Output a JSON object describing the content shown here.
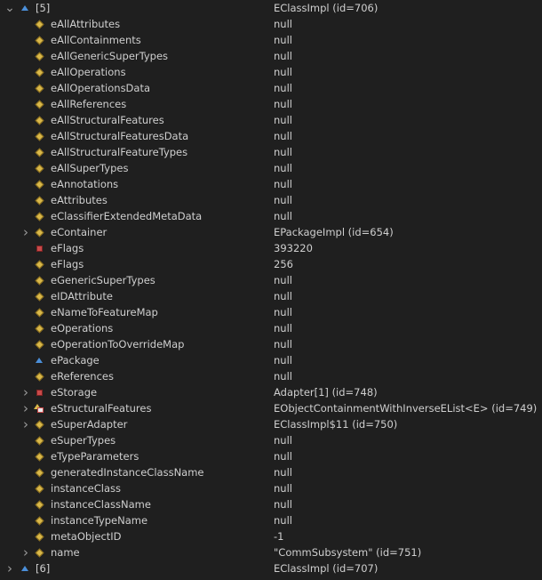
{
  "colors": {
    "background": "#1f1f1f",
    "text": "#cfcfcf",
    "diamond": "#d9b84a",
    "square": "#c94a4a",
    "triangle": "#4b8fd9"
  },
  "rows": [
    {
      "twisty": "chevron-down-icon",
      "icon": "triangle-blue-icon",
      "name": "[5]",
      "value": "EClassImpl  (id=706)",
      "level": 0
    },
    {
      "twisty": "",
      "icon": "diamond-yellow-icon",
      "name": "eAllAttributes",
      "value": "null",
      "level": 1
    },
    {
      "twisty": "",
      "icon": "diamond-yellow-icon",
      "name": "eAllContainments",
      "value": "null",
      "level": 1
    },
    {
      "twisty": "",
      "icon": "diamond-yellow-icon",
      "name": "eAllGenericSuperTypes",
      "value": "null",
      "level": 1
    },
    {
      "twisty": "",
      "icon": "diamond-yellow-icon",
      "name": "eAllOperations",
      "value": "null",
      "level": 1
    },
    {
      "twisty": "",
      "icon": "diamond-yellow-icon",
      "name": "eAllOperationsData",
      "value": "null",
      "level": 1
    },
    {
      "twisty": "",
      "icon": "diamond-yellow-icon",
      "name": "eAllReferences",
      "value": "null",
      "level": 1
    },
    {
      "twisty": "",
      "icon": "diamond-yellow-icon",
      "name": "eAllStructuralFeatures",
      "value": "null",
      "level": 1
    },
    {
      "twisty": "",
      "icon": "diamond-yellow-icon",
      "name": "eAllStructuralFeaturesData",
      "value": "null",
      "level": 1
    },
    {
      "twisty": "",
      "icon": "diamond-yellow-icon",
      "name": "eAllStructuralFeatureTypes",
      "value": "null",
      "level": 1
    },
    {
      "twisty": "",
      "icon": "diamond-yellow-icon",
      "name": "eAllSuperTypes",
      "value": "null",
      "level": 1
    },
    {
      "twisty": "",
      "icon": "diamond-yellow-icon",
      "name": "eAnnotations",
      "value": "null",
      "level": 1
    },
    {
      "twisty": "",
      "icon": "diamond-yellow-icon",
      "name": "eAttributes",
      "value": "null",
      "level": 1
    },
    {
      "twisty": "",
      "icon": "diamond-yellow-icon",
      "name": "eClassifierExtendedMetaData",
      "value": "null",
      "level": 1
    },
    {
      "twisty": "chevron-right-icon",
      "icon": "diamond-yellow-icon",
      "name": "eContainer",
      "value": "EPackageImpl  (id=654)",
      "level": 1
    },
    {
      "twisty": "",
      "icon": "square-red-icon",
      "name": "eFlags",
      "value": "393220",
      "level": 1
    },
    {
      "twisty": "",
      "icon": "diamond-yellow-icon",
      "name": "eFlags",
      "value": "256",
      "level": 1
    },
    {
      "twisty": "",
      "icon": "diamond-yellow-icon",
      "name": "eGenericSuperTypes",
      "value": "null",
      "level": 1
    },
    {
      "twisty": "",
      "icon": "diamond-yellow-icon",
      "name": "eIDAttribute",
      "value": "null",
      "level": 1
    },
    {
      "twisty": "",
      "icon": "diamond-yellow-icon",
      "name": "eNameToFeatureMap",
      "value": "null",
      "level": 1
    },
    {
      "twisty": "",
      "icon": "diamond-yellow-icon",
      "name": "eOperations",
      "value": "null",
      "level": 1
    },
    {
      "twisty": "",
      "icon": "diamond-yellow-icon",
      "name": "eOperationToOverrideMap",
      "value": "null",
      "level": 1
    },
    {
      "twisty": "",
      "icon": "triangle-blue-icon",
      "name": "ePackage",
      "value": "null",
      "level": 1
    },
    {
      "twisty": "",
      "icon": "diamond-yellow-icon",
      "name": "eReferences",
      "value": "null",
      "level": 1
    },
    {
      "twisty": "chevron-right-icon",
      "icon": "square-red-icon",
      "name": "eStorage",
      "value": "Adapter[1]  (id=748)",
      "level": 1
    },
    {
      "twisty": "chevron-right-icon",
      "icon": "mixed-icon",
      "name": "eStructuralFeatures",
      "value": "EObjectContainmentWithInverseEList<E>  (id=749)",
      "level": 1
    },
    {
      "twisty": "chevron-right-icon",
      "icon": "diamond-yellow-icon",
      "name": "eSuperAdapter",
      "value": "EClassImpl$11  (id=750)",
      "level": 1
    },
    {
      "twisty": "",
      "icon": "diamond-yellow-icon",
      "name": "eSuperTypes",
      "value": "null",
      "level": 1
    },
    {
      "twisty": "",
      "icon": "diamond-yellow-icon",
      "name": "eTypeParameters",
      "value": "null",
      "level": 1
    },
    {
      "twisty": "",
      "icon": "diamond-yellow-icon",
      "name": "generatedInstanceClassName",
      "value": "null",
      "level": 1
    },
    {
      "twisty": "",
      "icon": "diamond-yellow-icon",
      "name": "instanceClass",
      "value": "null",
      "level": 1
    },
    {
      "twisty": "",
      "icon": "diamond-yellow-icon",
      "name": "instanceClassName",
      "value": "null",
      "level": 1
    },
    {
      "twisty": "",
      "icon": "diamond-yellow-icon",
      "name": "instanceTypeName",
      "value": "null",
      "level": 1
    },
    {
      "twisty": "",
      "icon": "diamond-yellow-icon",
      "name": "metaObjectID",
      "value": "-1",
      "level": 1
    },
    {
      "twisty": "chevron-right-icon",
      "icon": "diamond-yellow-icon",
      "name": "name",
      "value": "\"CommSubsystem\" (id=751)",
      "level": 1
    },
    {
      "twisty": "chevron-right-icon",
      "icon": "triangle-blue-icon",
      "name": "[6]",
      "value": "EClassImpl  (id=707)",
      "level": 0
    }
  ]
}
